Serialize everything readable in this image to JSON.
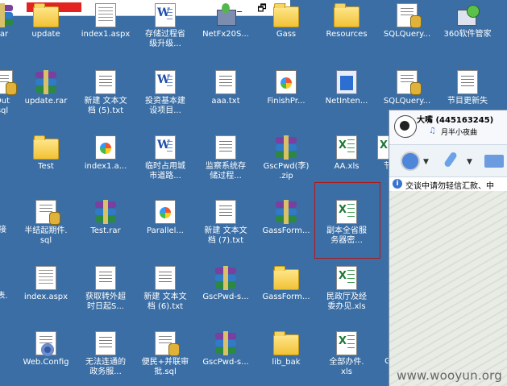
{
  "window": {
    "controls": [
      "_",
      "🗗",
      "✕"
    ]
  },
  "desktop": {
    "icons": [
      {
        "label": "rar",
        "type": "rar"
      },
      {
        "label": "update",
        "type": "folder"
      },
      {
        "label": "index1.aspx",
        "type": "aspx"
      },
      {
        "label": "存储过程省\n级升级...",
        "type": "word"
      },
      {
        "label": "NetFx20S...",
        "type": "install"
      },
      {
        "label": "Gass",
        "type": "folder"
      },
      {
        "label": "Resources",
        "type": "folder"
      },
      {
        "label": "SQLQuery...",
        "type": "sql"
      },
      {
        "label": "360软件管家",
        "type": "setup"
      },
      {
        "label": "Out\nsql",
        "type": "sql"
      },
      {
        "label": "update.rar",
        "type": "rar"
      },
      {
        "label": "新建 文本文\n档 (5).txt",
        "type": "txt"
      },
      {
        "label": "投资基本建\n设项目...",
        "type": "word2"
      },
      {
        "label": "aaa.txt",
        "type": "txt"
      },
      {
        "label": "FinishPr...",
        "type": "html"
      },
      {
        "label": "NetInten...",
        "type": "disk"
      },
      {
        "label": "SQLQuery...",
        "type": "sql"
      },
      {
        "label": "节目更新失",
        "type": "txt"
      },
      {
        "label": "",
        "type": "blank"
      },
      {
        "label": "Test",
        "type": "folder"
      },
      {
        "label": "index1.a...",
        "type": "html"
      },
      {
        "label": "临时占用城\n市道路...",
        "type": "word"
      },
      {
        "label": "监察系统存\n储过程...",
        "type": "txt"
      },
      {
        "label": "GscPwd(李)\n.zip",
        "type": "rar"
      },
      {
        "label": "AA.xls",
        "type": "xls"
      },
      {
        "label": "节",
        "type": "xls"
      },
      {
        "label": "接",
        "type": "blank"
      },
      {
        "label": "半结起期件.\nsql",
        "type": "sql"
      },
      {
        "label": "Test.rar",
        "type": "rar"
      },
      {
        "label": "Parallel...",
        "type": "html"
      },
      {
        "label": "新建 文本文\n档 (7).txt",
        "type": "txt"
      },
      {
        "label": "GassForm...",
        "type": "rar"
      },
      {
        "label": "副本全省服\n务器密...",
        "type": "xls"
      },
      {
        "label": "表.",
        "type": "blank"
      },
      {
        "label": "index.aspx",
        "type": "aspx"
      },
      {
        "label": "获取转外超\n时日起S...",
        "type": "txt"
      },
      {
        "label": "新建 文本文\n档 (6).txt",
        "type": "txt"
      },
      {
        "label": "GscPwd-s...",
        "type": "rar"
      },
      {
        "label": "GassForm...",
        "type": "folder"
      },
      {
        "label": "民政厅及经\n委办见.xls",
        "type": "xls"
      },
      {
        "label": "",
        "type": "blank"
      },
      {
        "label": "Web.Config",
        "type": "config"
      },
      {
        "label": "无法连通的\n政务服...",
        "type": "txt"
      },
      {
        "label": "便民+并联审\n批.sql",
        "type": "sql"
      },
      {
        "label": "GscPwd-s...",
        "type": "rar"
      },
      {
        "label": "lib_bak",
        "type": "folder"
      },
      {
        "label": "全部办件.\nxls",
        "type": "xls"
      },
      {
        "label": "G",
        "type": "blank"
      }
    ]
  },
  "qq": {
    "name": "大嘴 (445163245)",
    "mood": "月半小夜曲",
    "tip": "交谈中请勿轻信汇款、中"
  },
  "watermark": "www.wooyun.org"
}
